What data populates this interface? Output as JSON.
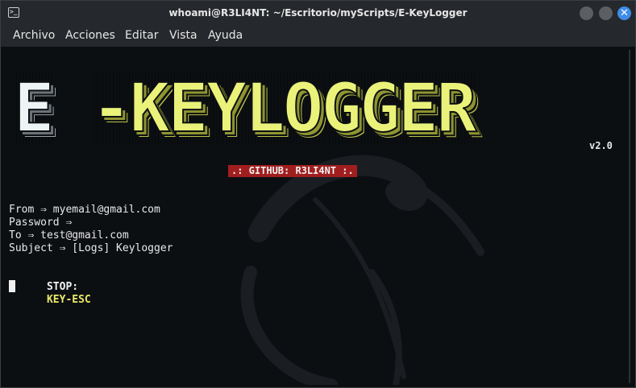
{
  "window": {
    "title": "whoami@R3LI4NT: ~/Escritorio/myScripts/E-KeyLogger",
    "close_glyph": "✕"
  },
  "menu": {
    "items": [
      "Archivo",
      "Acciones",
      "Editar",
      "Vista",
      "Ayuda"
    ]
  },
  "terminal": {
    "banner": {
      "logo_first": "E",
      "logo_rest": "-KEYLOGGER",
      "version": "v2.0",
      "github": ".: GITHUB: R3LI4NT :."
    },
    "lines": [
      "From ⇒ myemail@gmail.com",
      "Password ⇒",
      "To ⇒ test@gmail.com",
      "Subject ⇒ [Logs] Keylogger"
    ],
    "stop": {
      "label": "STOP:",
      "key": "KEY-ESC"
    }
  },
  "colors": {
    "terminal_bg": "#0c0f12",
    "logo_yellow": "#eaf27a",
    "badge_red": "#a11e1e",
    "accent_blue": "#3f8ce8"
  }
}
